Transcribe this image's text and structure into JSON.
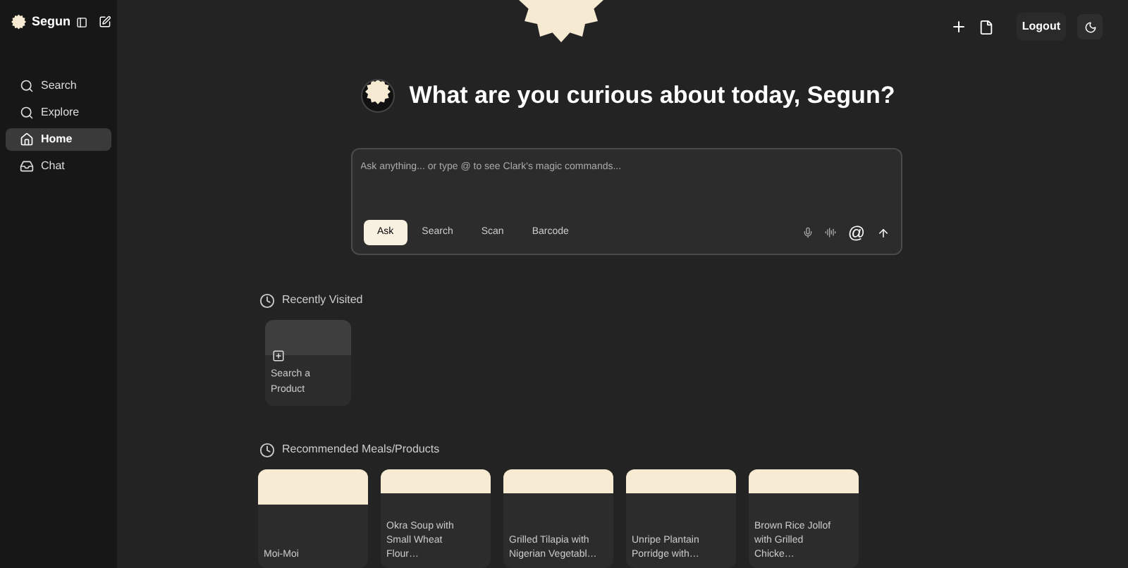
{
  "sidebar": {
    "user": "Segun",
    "items": [
      {
        "label": "Search",
        "kind": "search",
        "selected": false
      },
      {
        "label": "Explore",
        "kind": "search",
        "selected": false
      },
      {
        "label": "Home",
        "kind": "home",
        "selected": true
      },
      {
        "label": "Chat",
        "kind": "chat",
        "selected": false
      }
    ]
  },
  "header": {
    "logout": "Logout"
  },
  "greeting": "What are you curious about today, Segun?",
  "prompt": {
    "placeholder": "Ask anything... or type @ to see Clark's magic commands...",
    "modes": [
      {
        "label": "Ask",
        "selected": true
      },
      {
        "label": "Search",
        "selected": false
      },
      {
        "label": "Scan",
        "selected": false
      },
      {
        "label": "Barcode",
        "selected": false
      }
    ],
    "at": "@"
  },
  "recent": {
    "title": "Recently Visited",
    "cards": [
      {
        "label": "Search a Product"
      }
    ]
  },
  "recommended": {
    "title": "Recommended Meals/Products",
    "cards": [
      {
        "label": "Moi-Moi",
        "tall": true
      },
      {
        "label": "Okra Soup with Small Wheat Flour…",
        "tall": false
      },
      {
        "label": "Grilled Tilapia with Nigerian Vegetabl…",
        "tall": false
      },
      {
        "label": "Unripe Plantain Porridge with…",
        "tall": false
      },
      {
        "label": "Brown Rice Jollof with Grilled Chicke…",
        "tall": false
      }
    ]
  }
}
